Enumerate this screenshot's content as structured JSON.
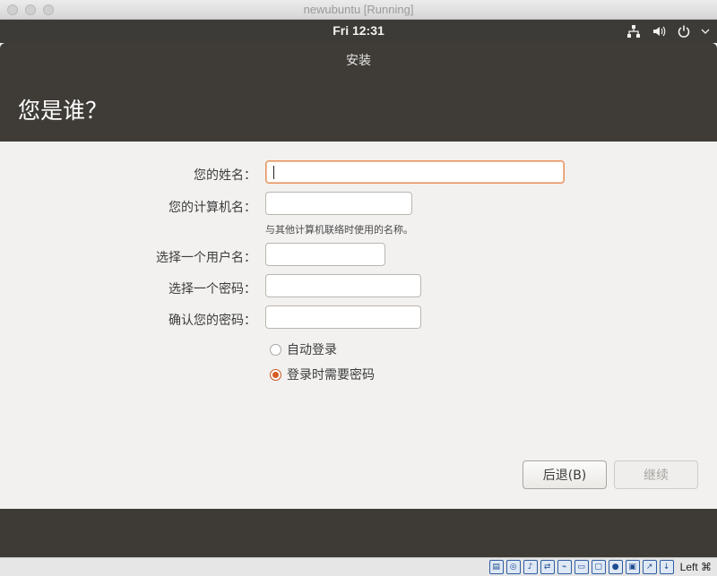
{
  "window": {
    "title": "newubuntu [Running]"
  },
  "panel": {
    "clock": "Fri 12:31"
  },
  "tray_icons": [
    "network-icon",
    "volume-icon",
    "power-icon"
  ],
  "installer": {
    "title": "安装",
    "heading": "您是谁？",
    "form": {
      "name_label": "您的姓名：",
      "name_value": "",
      "computer_label": "您的计算机名：",
      "computer_value": "",
      "computer_hint": "与其他计算机联络时使用的名称。",
      "username_label": "选择一个用户名：",
      "username_value": "",
      "password_label": "选择一个密码：",
      "password_value": "",
      "confirm_label": "确认您的密码：",
      "confirm_value": ""
    },
    "login_options": {
      "auto_login": "自动登录",
      "require_password": "登录时需要密码",
      "selected": "require_password"
    },
    "buttons": {
      "back": "后退(B)",
      "continue": "继续"
    },
    "progress": {
      "total_steps": 7
    }
  },
  "statusbar": {
    "host_key": "Left ⌘"
  },
  "colors": {
    "accent": "#e8793f",
    "panel": "#3c3b37",
    "header": "#3f3c37"
  }
}
